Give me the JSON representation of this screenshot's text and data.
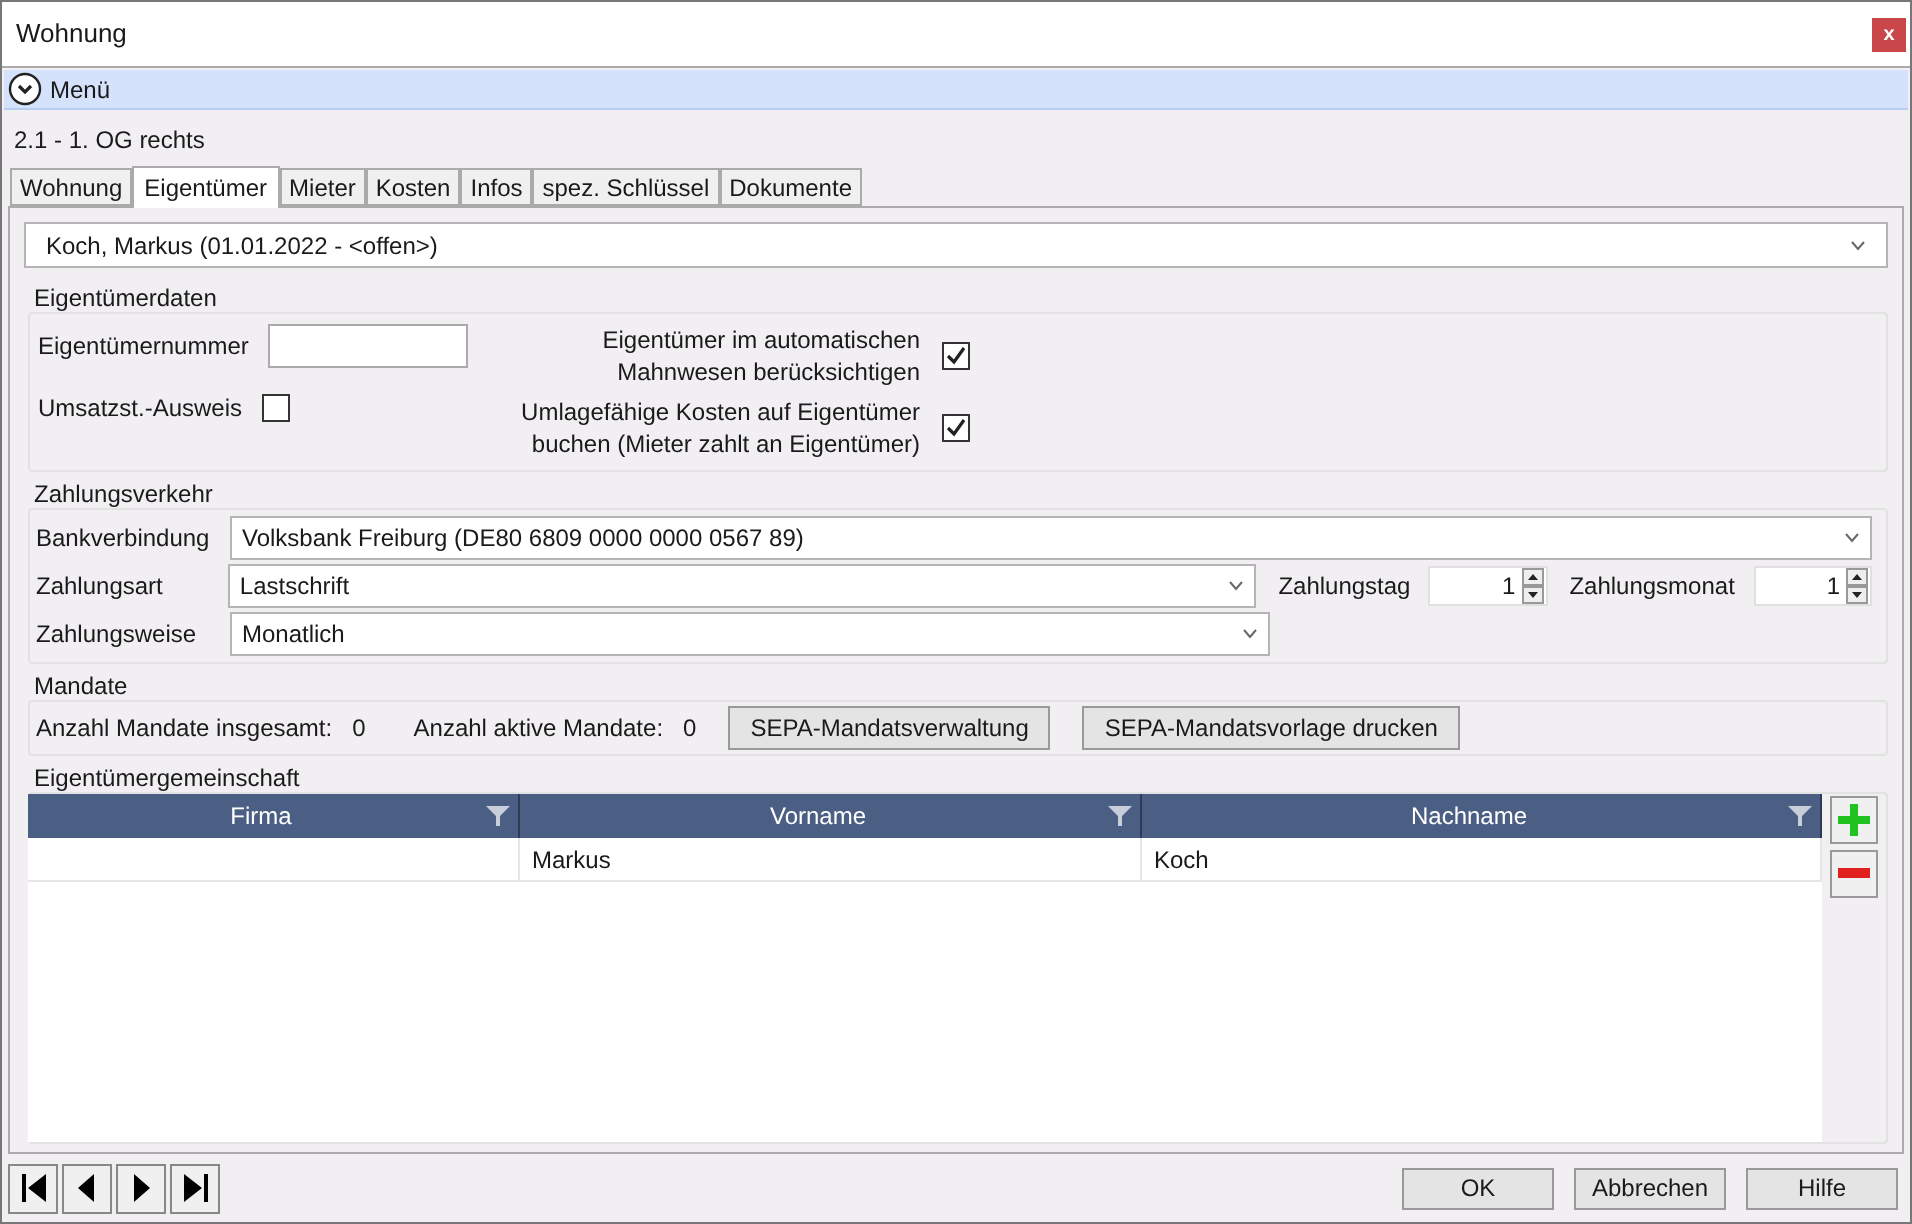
{
  "window": {
    "title": "Wohnung",
    "close": "x"
  },
  "menu": {
    "label": "Menü"
  },
  "breadcrumb": "2.1 - 1. OG rechts",
  "tabs": [
    {
      "label": "Wohnung",
      "selected": false
    },
    {
      "label": "Eigentümer",
      "selected": true
    },
    {
      "label": "Mieter",
      "selected": false
    },
    {
      "label": "Kosten",
      "selected": false
    },
    {
      "label": "Infos",
      "selected": false
    },
    {
      "label": "spez. Schlüssel",
      "selected": false
    },
    {
      "label": "Dokumente",
      "selected": false
    }
  ],
  "owner_select": {
    "value": "Koch, Markus (01.01.2022 - <offen>)"
  },
  "eigentuemerdaten": {
    "title": "Eigentümerdaten",
    "number_label": "Eigentümernummer",
    "vat_label": "Umsatzst.-Ausweis",
    "vat_checked": false,
    "options": [
      {
        "label": "Eigentümer im automatischen Mahnwesen berücksichtigen",
        "checked": true
      },
      {
        "label": "Umlagefähige Kosten auf Eigentümer buchen (Mieter zahlt an Eigentümer)",
        "checked": true
      }
    ]
  },
  "zahlungsverkehr": {
    "title": "Zahlungsverkehr",
    "bank_label": "Bankverbindung",
    "bank_value": "Volksbank Freiburg (DE80 6809 0000 0000 0567 89)",
    "art_label": "Zahlungsart",
    "art_value": "Lastschrift",
    "weise_label": "Zahlungsweise",
    "weise_value": "Monatlich",
    "tag_label": "Zahlungstag",
    "tag_value": "1",
    "monat_label": "Zahlungsmonat",
    "monat_value": "1"
  },
  "mandate": {
    "title": "Mandate",
    "total_label": "Anzahl Mandate insgesamt:",
    "total_value": "0",
    "active_label": "Anzahl aktive Mandate:",
    "active_value": "0",
    "buttons": [
      "SEPA-Mandatsverwaltung",
      "SEPA-Mandatsvorlage drucken"
    ]
  },
  "gemeinschaft": {
    "title": "Eigentümergemeinschaft",
    "columns": [
      "Firma",
      "Vorname",
      "Nachname"
    ],
    "rows": [
      [
        "",
        "Markus",
        "Koch"
      ]
    ]
  },
  "footer_buttons": [
    "OK",
    "Abbrechen",
    "Hilfe"
  ]
}
